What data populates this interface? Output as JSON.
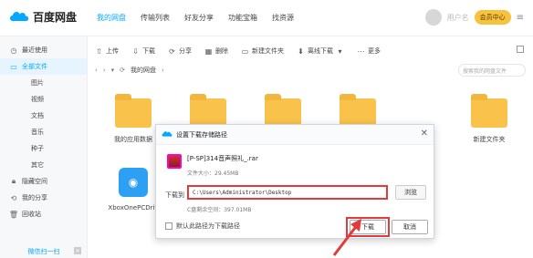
{
  "app": {
    "title": "百度网盘",
    "nav": [
      "我的网盘",
      "传输列表",
      "好友分享",
      "功能宝箱",
      "找资源"
    ],
    "vip_label": "会员中心",
    "username": "用户名"
  },
  "sidebar": {
    "items": [
      {
        "label": "最近使用",
        "icon": "clock-icon"
      },
      {
        "label": "全部文件",
        "icon": "folder-icon",
        "active": true
      },
      {
        "label": "图片",
        "sub": true
      },
      {
        "label": "视频",
        "sub": true
      },
      {
        "label": "文档",
        "sub": true
      },
      {
        "label": "音乐",
        "sub": true
      },
      {
        "label": "种子",
        "sub": true
      },
      {
        "label": "其它",
        "sub": true
      },
      {
        "label": "隐藏空间",
        "icon": "lock-icon"
      },
      {
        "label": "我的分享",
        "icon": "share-icon"
      },
      {
        "label": "回收站",
        "icon": "trash-icon"
      }
    ],
    "footer": "微信扫一扫"
  },
  "toolbar": {
    "buttons": [
      "上传",
      "下载",
      "分享",
      "删除",
      "新建文件夹",
      "离线下载",
      "更多"
    ]
  },
  "breadcrumb": {
    "path": "我的网盘",
    "search_placeholder": "搜索我的网盘文件"
  },
  "files": [
    {
      "name": "我的应用数据",
      "type": "folder"
    },
    {
      "name": "",
      "type": "folder"
    },
    {
      "name": "",
      "type": "folder"
    },
    {
      "name": "",
      "type": "folder"
    },
    {
      "name": "新建文件夹",
      "type": "folder"
    },
    {
      "name": "XboxOnePCDriv",
      "type": "app"
    }
  ],
  "dialog": {
    "title": "设置下载存储路径",
    "file_name": "[P-SP]314音声照礼_.rar",
    "file_size": "文件大小：29.45MB",
    "path_label": "下载到",
    "path_value": "C:\\Users\\Administrator\\Desktop",
    "browse_label": "浏览",
    "space_info": "C盘剩余空间：397.01MB",
    "default_label": "默认此路径为下载路径",
    "download_label": "下载",
    "cancel_label": "取消"
  },
  "colors": {
    "accent": "#06a7ff",
    "highlight": "#e23b3b",
    "vip": "#f7c23c"
  }
}
